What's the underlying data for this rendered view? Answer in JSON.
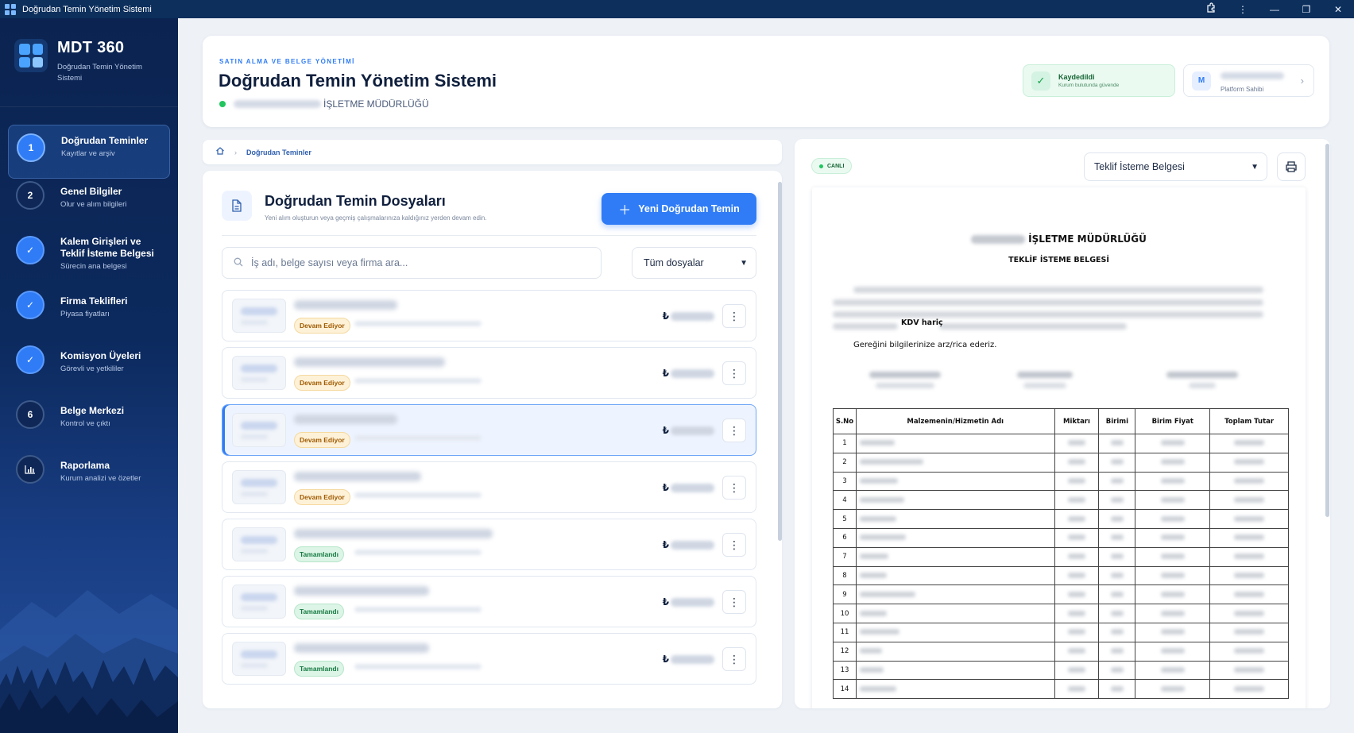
{
  "window": {
    "title": "Doğrudan Temin Yönetim Sistemi"
  },
  "brand": {
    "name": "MDT 360",
    "subtitle": "Doğrudan Temin Yönetim Sistemi"
  },
  "steps": [
    {
      "marker": "1",
      "title": "Doğrudan Teminler",
      "subtitle": "Kayıtlar ve arşiv",
      "state": "active"
    },
    {
      "marker": "2",
      "title": "Genel Bilgiler",
      "subtitle": "Olur ve alım bilgileri",
      "state": "pending"
    },
    {
      "marker": "✓",
      "title": "Kalem Girişleri ve Teklif İsteme Belgesi",
      "subtitle": "Sürecin ana belgesi",
      "state": "done"
    },
    {
      "marker": "✓",
      "title": "Firma Teklifleri",
      "subtitle": "Piyasa fiyatları",
      "state": "done"
    },
    {
      "marker": "✓",
      "title": "Komisyon Üyeleri",
      "subtitle": "Görevli ve yetkililer",
      "state": "done"
    },
    {
      "marker": "6",
      "title": "Belge Merkezi",
      "subtitle": "Kontrol ve çıktı",
      "state": "pending"
    },
    {
      "marker": "chart-icon",
      "title": "Raporlama",
      "subtitle": "Kurum analizi ve özetler",
      "state": "pending"
    }
  ],
  "header": {
    "kicker": "SATIN ALMA VE BELGE YÖNETİMİ",
    "title": "Doğrudan Temin Yönetim Sistemi",
    "org_suffix": "İŞLETME MÜDÜRLÜĞÜ",
    "saved_title": "Kaydedildi",
    "saved_sub": "Kurum bulutunda güvende",
    "owner_initial": "M",
    "owner_role": "Platform Sahibi"
  },
  "breadcrumb": {
    "current": "Doğrudan Teminler"
  },
  "files": {
    "title": "Doğrudan Temin Dosyaları",
    "subtitle": "Yeni alım oluşturun veya geçmiş çalışmalarınıza kaldığınız yerden devam edin.",
    "new_button": "Yeni Doğrudan Temin",
    "search_placeholder": "İş adı, belge sayısı veya firma ara...",
    "filter_value": "Tüm dosyalar",
    "currency": "₺",
    "rows": [
      {
        "status": "Devam Ediyor",
        "status_type": "progress"
      },
      {
        "status": "Devam Ediyor",
        "status_type": "progress"
      },
      {
        "status": "Devam Ediyor",
        "status_type": "progress",
        "selected": true
      },
      {
        "status": "Devam Ediyor",
        "status_type": "progress"
      },
      {
        "status": "Tamamlandı",
        "status_type": "done"
      },
      {
        "status": "Tamamlandı",
        "status_type": "done"
      },
      {
        "status": "Tamamlandı",
        "status_type": "done"
      }
    ]
  },
  "preview": {
    "live_label": "CANLI",
    "document_select": "Teklif İsteme Belgesi",
    "paper": {
      "org": "İŞLETME MÜDÜRLÜĞÜ",
      "doc_title": "TEKLİF İSTEME BELGESİ",
      "kdv_text": "KDV hariç",
      "closing": "Gereğini bilgilerinize arz/rica ederiz.",
      "table_headers": [
        "S.No",
        "Malzemenin/Hizmetin Adı",
        "Miktarı",
        "Birimi",
        "Birim Fiyat",
        "Toplam Tutar"
      ],
      "row_numbers": [
        "1",
        "2",
        "3",
        "4",
        "5",
        "6",
        "7",
        "8",
        "9",
        "10",
        "11",
        "12",
        "13",
        "14"
      ]
    }
  },
  "colors": {
    "accent": "#2f7cf6",
    "sidebar": "#0b2350",
    "success": "#22c55e",
    "warning_badge": "#fdf1d7"
  }
}
